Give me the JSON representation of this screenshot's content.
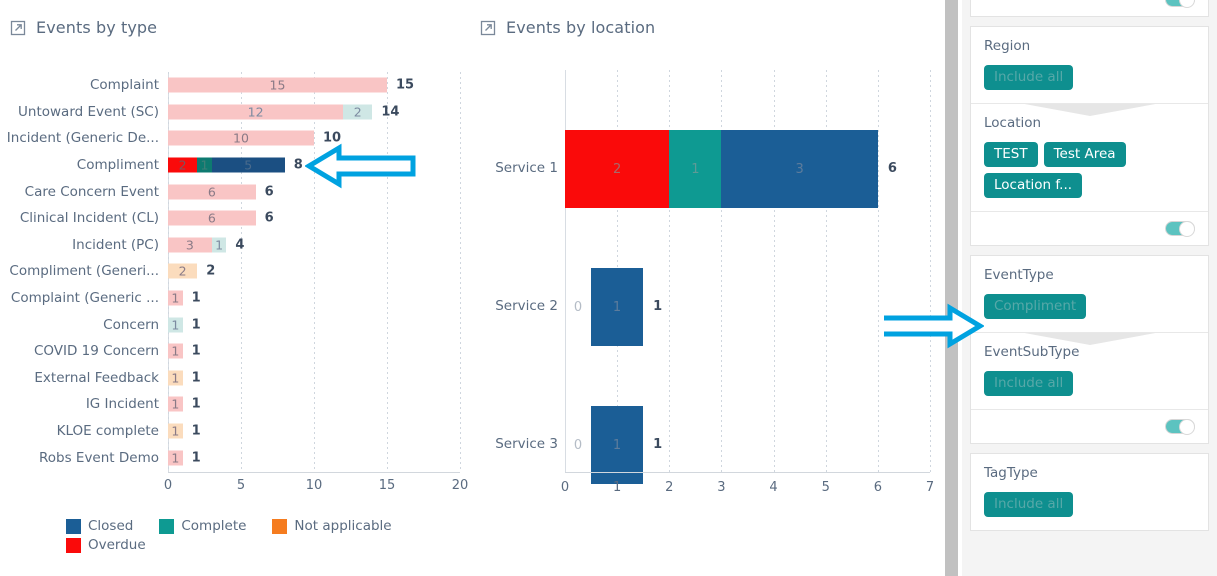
{
  "accent": {
    "teal": "#0e8f8f",
    "arrow": "#00A2E0",
    "closed": "#1b5e96",
    "complete": "#0e9a92",
    "overdue": "#fa0a0a",
    "not_applicable": "#f57c1f"
  },
  "charts": {
    "events_by_type": {
      "title": "Events by type",
      "popout_icon": "popout-icon"
    },
    "events_by_location": {
      "title": "Events by location",
      "popout_icon": "popout-icon"
    }
  },
  "chart_data": [
    {
      "type": "bar",
      "orientation": "horizontal",
      "stacked": true,
      "title": "Events by type",
      "xlabel": "",
      "ylabel": "",
      "xlim": [
        0,
        20
      ],
      "xticks": [
        "0",
        "5",
        "10",
        "15",
        "20"
      ],
      "grid": true,
      "legend_position": "bottom",
      "legend": [
        {
          "name": "Closed",
          "color": "#1b5e96"
        },
        {
          "name": "Complete",
          "color": "#0e9a92"
        },
        {
          "name": "Not applicable",
          "color": "#f57c1f"
        },
        {
          "name": "Overdue",
          "color": "#fa0a0a"
        }
      ],
      "categories": [
        "Complaint",
        "Untoward Event (SC)",
        "Incident (Generic De...",
        "Compliment",
        "Care Concern Event",
        "Clinical Incident (CL)",
        "Incident (PC)",
        "Compliment (Generi...",
        "Complaint (Generic ...",
        "Concern",
        "COVID 19 Concern",
        "External Feedback",
        "IG Incident",
        "KLOE complete",
        "Robs Event Demo"
      ],
      "rows": [
        {
          "category": "Complaint",
          "total": "15",
          "segments": [
            {
              "series": "Overdue",
              "value": 15,
              "label": "15",
              "color": "#f9c5c5",
              "text": "#8a7a86",
              "faded": true
            }
          ]
        },
        {
          "category": "Untoward Event (SC)",
          "total": "14",
          "segments": [
            {
              "series": "Overdue",
              "value": 12,
              "label": "12",
              "color": "#f9c5c5",
              "text": "#7c8aa0",
              "faded": true
            },
            {
              "series": "Complete",
              "value": 2,
              "label": "2",
              "color": "#cfe7e5",
              "text": "#7c8aa0",
              "faded": true
            }
          ]
        },
        {
          "category": "Incident (Generic De...",
          "total": "10",
          "segments": [
            {
              "series": "Overdue",
              "value": 10,
              "label": "10",
              "color": "#f9c5c5",
              "text": "#8a7a86",
              "faded": true
            }
          ]
        },
        {
          "category": "Compliment",
          "total": "8",
          "segments": [
            {
              "series": "Overdue",
              "value": 2,
              "label": "2",
              "color": "#fa0a0a",
              "text": "#7a5560",
              "faded": false
            },
            {
              "series": "Complete",
              "value": 1,
              "label": "1",
              "color": "#0e7a70",
              "text": "#3f7f78",
              "faded": false
            },
            {
              "series": "Closed",
              "value": 5,
              "label": "5",
              "color": "#1b4f82",
              "text": "#4a6b8c",
              "faded": false
            }
          ]
        },
        {
          "category": "Care Concern Event",
          "total": "6",
          "segments": [
            {
              "series": "Overdue",
              "value": 6,
              "label": "6",
              "color": "#f9c5c5",
              "text": "#8a7a86",
              "faded": true
            }
          ]
        },
        {
          "category": "Clinical Incident (CL)",
          "total": "6",
          "segments": [
            {
              "series": "Overdue",
              "value": 6,
              "label": "6",
              "color": "#f9c5c5",
              "text": "#8a7a86",
              "faded": true
            }
          ]
        },
        {
          "category": "Incident (PC)",
          "total": "4",
          "segments": [
            {
              "series": "Overdue",
              "value": 3,
              "label": "3",
              "color": "#f9c5c5",
              "text": "#8a7a86",
              "faded": true
            },
            {
              "series": "Complete",
              "value": 1,
              "label": "1",
              "color": "#cfe7e5",
              "text": "#7c8aa0",
              "faded": true
            }
          ]
        },
        {
          "category": "Compliment (Generi...",
          "total": "2",
          "segments": [
            {
              "series": "Not applicable",
              "value": 2,
              "label": "2",
              "color": "#fbdcbd",
              "text": "#8a7a86",
              "faded": true
            }
          ]
        },
        {
          "category": "Complaint (Generic ...",
          "total": "1",
          "segments": [
            {
              "series": "Overdue",
              "value": 1,
              "label": "1",
              "color": "#f9c5c5",
              "text": "#8a7a86",
              "faded": true
            }
          ]
        },
        {
          "category": "Concern",
          "total": "1",
          "segments": [
            {
              "series": "Complete",
              "value": 1,
              "label": "1",
              "color": "#cfe7e5",
              "text": "#7c8aa0",
              "faded": true
            }
          ]
        },
        {
          "category": "COVID 19 Concern",
          "total": "1",
          "segments": [
            {
              "series": "Overdue",
              "value": 1,
              "label": "1",
              "color": "#f9c5c5",
              "text": "#8a7a86",
              "faded": true
            }
          ]
        },
        {
          "category": "External Feedback",
          "total": "1",
          "segments": [
            {
              "series": "Not applicable",
              "value": 1,
              "label": "1",
              "color": "#fbdcbd",
              "text": "#8a7a86",
              "faded": true
            }
          ]
        },
        {
          "category": "IG Incident",
          "total": "1",
          "segments": [
            {
              "series": "Overdue",
              "value": 1,
              "label": "1",
              "color": "#f9c5c5",
              "text": "#8a7a86",
              "faded": true
            }
          ]
        },
        {
          "category": "KLOE complete",
          "total": "1",
          "segments": [
            {
              "series": "Not applicable",
              "value": 1,
              "label": "1",
              "color": "#fbdcbd",
              "text": "#8a7a86",
              "faded": true
            }
          ]
        },
        {
          "category": "Robs Event Demo",
          "total": "1",
          "segments": [
            {
              "series": "Overdue",
              "value": 1,
              "label": "1",
              "color": "#f9c5c5",
              "text": "#8a7a86",
              "faded": true
            }
          ]
        }
      ]
    },
    {
      "type": "bar",
      "orientation": "horizontal",
      "stacked": true,
      "title": "Events by location",
      "xlabel": "",
      "ylabel": "",
      "xlim": [
        0,
        7
      ],
      "xticks": [
        "0",
        "1",
        "2",
        "3",
        "4",
        "5",
        "6",
        "7"
      ],
      "grid": true,
      "legend_position": "bottom",
      "legend": [
        {
          "name": "Closed",
          "color": "#1b5e96"
        },
        {
          "name": "Complete",
          "color": "#0e9a92"
        },
        {
          "name": "Overdue",
          "color": "#fa0a0a"
        }
      ],
      "categories": [
        "Service 1",
        "Service 2",
        "Service 3"
      ],
      "rows": [
        {
          "category": "Service 1",
          "total": "6",
          "segments": [
            {
              "series": "Overdue",
              "value": 2,
              "label": "2",
              "color": "#fa0a0a",
              "text": "#a86a6a"
            },
            {
              "series": "Complete",
              "value": 1,
              "label": "1",
              "color": "#0e9a92",
              "text": "#5f9a96"
            },
            {
              "series": "Closed",
              "value": 3,
              "label": "3",
              "color": "#1b5e96",
              "text": "#5d7c9c"
            }
          ]
        },
        {
          "category": "Service 2",
          "total": "1",
          "segments": [
            {
              "series": "Overdue",
              "value": 0,
              "label": "0",
              "color": "transparent",
              "text": "#b4bcc6"
            },
            {
              "series": "Closed",
              "value": 1,
              "label": "1",
              "color": "#1b5e96",
              "text": "#5d7c9c"
            }
          ]
        },
        {
          "category": "Service 3",
          "total": "1",
          "segments": [
            {
              "series": "Overdue",
              "value": 0,
              "label": "0",
              "color": "transparent",
              "text": "#b4bcc6"
            },
            {
              "series": "Closed",
              "value": 1,
              "label": "1",
              "color": "#1b5e96",
              "text": "#5d7c9c"
            }
          ]
        }
      ]
    }
  ],
  "sidebar": {
    "top_toggle": {
      "name": "top-toggle",
      "on": true
    },
    "cards": [
      {
        "id": "region-location",
        "sections": [
          {
            "title": "Region",
            "chips": [
              {
                "label": "Include all",
                "dim": true
              }
            ],
            "notch": false
          },
          {
            "title": "Location",
            "chips": [
              {
                "label": "TEST",
                "dim": false
              },
              {
                "label": "Test Area",
                "dim": false
              },
              {
                "label": "Location f...",
                "dim": false
              }
            ],
            "notch": true
          }
        ],
        "toggle": {
          "on": true
        }
      },
      {
        "id": "eventtype-eventsubtype",
        "sections": [
          {
            "title": "EventType",
            "chips": [
              {
                "label": "Compliment",
                "dim": true
              }
            ],
            "notch": false
          },
          {
            "title": "EventSubType",
            "chips": [
              {
                "label": "Include all",
                "dim": true
              }
            ],
            "notch": true
          }
        ],
        "toggle": {
          "on": true
        }
      },
      {
        "id": "tagtype",
        "sections": [
          {
            "title": "TagType",
            "chips": [
              {
                "label": "Include all",
                "dim": true
              }
            ],
            "notch": false
          }
        ],
        "toggle": null
      }
    ]
  },
  "annotations": [
    {
      "name": "arrow-pointing-to-compliment-bar",
      "direction": "left"
    },
    {
      "name": "arrow-pointing-to-eventtype-filter",
      "direction": "right"
    }
  ]
}
